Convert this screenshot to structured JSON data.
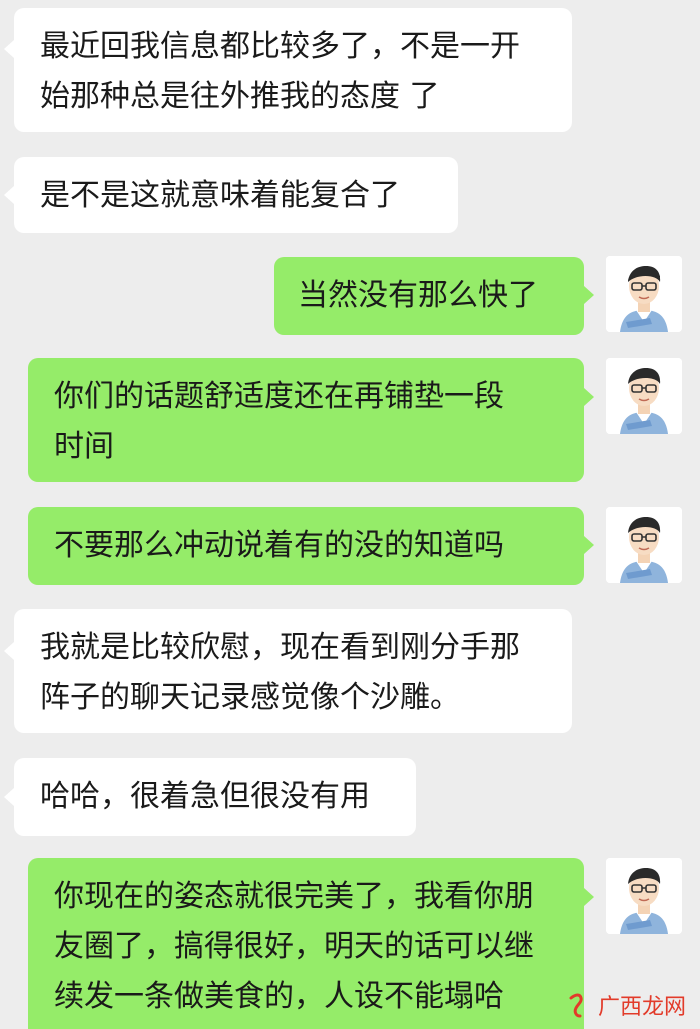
{
  "messages": [
    {
      "direction": "incoming",
      "text": "最近回我信息都比较多了，不是一开\n始那种总是往外推我的态度 了"
    },
    {
      "direction": "incoming",
      "text": "是不是这就意味着能复合了"
    },
    {
      "direction": "outgoing",
      "text": "当然没有那么快了"
    },
    {
      "direction": "outgoing",
      "text": "你们的话题舒适度还在再铺垫一段\n时间"
    },
    {
      "direction": "outgoing",
      "text": "不要那么冲动说着有的没的知道吗"
    },
    {
      "direction": "incoming",
      "text": "我就是比较欣慰，现在看到刚分手那\n阵子的聊天记录感觉像个沙雕。"
    },
    {
      "direction": "incoming",
      "text": "哈哈，很着急但很没有用"
    },
    {
      "direction": "outgoing",
      "text": "你现在的姿态就很完美了，我看你朋\n友圈了，搞得很好，明天的话可以继\n续发一条做美食的，人设不能塌哈"
    }
  ],
  "watermark": {
    "text": "广西龙网"
  },
  "colors": {
    "incoming_bubble": "#ffffff",
    "outgoing_bubble": "#95ec69",
    "background": "#ededed"
  }
}
